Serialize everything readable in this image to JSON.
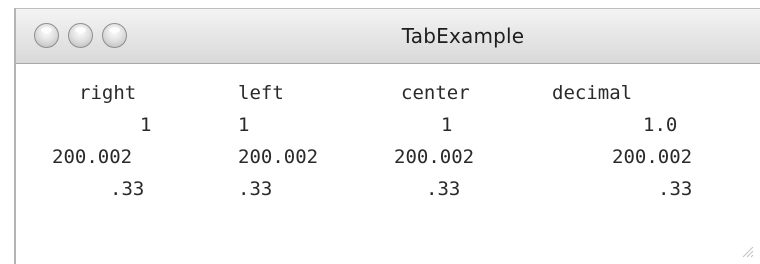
{
  "window": {
    "title": "TabExample"
  },
  "columns": [
    {
      "header": "right",
      "rows": [
        "1",
        "200.002",
        ".33"
      ]
    },
    {
      "header": "left",
      "rows": [
        "1",
        "200.002",
        ".33"
      ]
    },
    {
      "header": "center",
      "rows": [
        "1",
        "200.002",
        ".33"
      ]
    },
    {
      "header": "decimal",
      "rows": [
        "1.0",
        "200.002",
        ".33"
      ]
    }
  ]
}
